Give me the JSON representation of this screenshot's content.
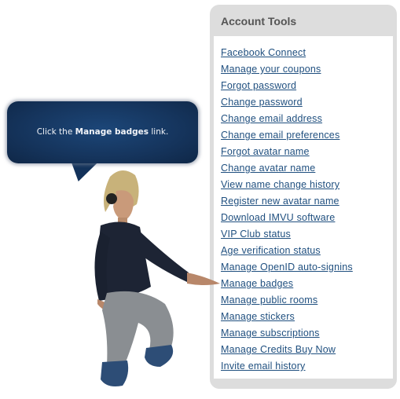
{
  "panel": {
    "title": "Account Tools",
    "links": [
      "Facebook Connect",
      "Manage your coupons",
      "Forgot password",
      "Change password",
      "Change email address",
      "Change email preferences",
      "Forgot avatar name",
      "Change avatar name",
      "View name change history",
      "Register new avatar name",
      "Download IMVU software",
      "VIP Club status",
      "Age verification status",
      "Manage OpenID auto-signins",
      "Manage badges",
      "Manage public rooms",
      "Manage stickers",
      "Manage subscriptions",
      "Manage Credits Buy Now",
      "Invite email history"
    ]
  },
  "tooltip": {
    "prefix": "Click the ",
    "emphasis": "Manage badges",
    "suffix": " link."
  },
  "colors": {
    "link": "#1f4f7f",
    "panel_bg": "#dddddd",
    "bubble": "#15345c"
  }
}
